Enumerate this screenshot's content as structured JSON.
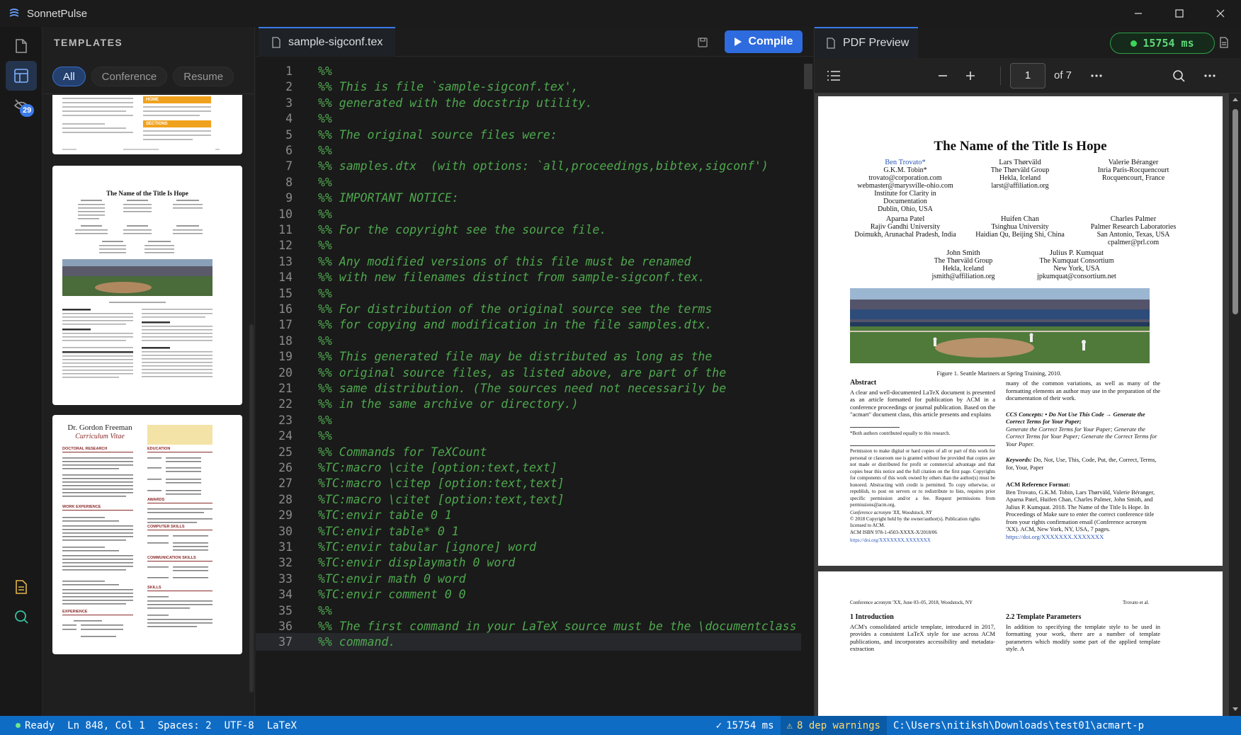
{
  "window": {
    "title": "SonnetPulse"
  },
  "activity": {
    "badge_count": "29"
  },
  "sidebar": {
    "title": "TEMPLATES",
    "filters": [
      {
        "label": "All"
      },
      {
        "label": "Conference"
      },
      {
        "label": "Resume"
      }
    ],
    "card1": {
      "box1": "HOME",
      "box2": "SECTIONS"
    },
    "card2": {
      "title": "The Name of the Title Is Hope"
    },
    "card3": {
      "name": "Dr. Gordon Freeman",
      "subtitle": "Curriculum Vitae",
      "h1": "DOCTORAL RESEARCH",
      "h2": "WORK EXPERIENCE",
      "h3": "EXPERIENCE",
      "r1": "EDUCATION",
      "r2": "AWARDS",
      "r3": "COMPUTER SKILLS",
      "r4": "COMMUNICATION SKILLS",
      "r5": "SKILLS"
    }
  },
  "editor": {
    "tab": {
      "filename": "sample-sigconf.tex"
    },
    "compile_label": "Compile",
    "lines": [
      {
        "n": "1",
        "t": "%%"
      },
      {
        "n": "2",
        "t": "%% This is file `sample-sigconf.tex',"
      },
      {
        "n": "3",
        "t": "%% generated with the docstrip utility."
      },
      {
        "n": "4",
        "t": "%%"
      },
      {
        "n": "5",
        "t": "%% The original source files were:"
      },
      {
        "n": "6",
        "t": "%%"
      },
      {
        "n": "7",
        "t": "%% samples.dtx  (with options: `all,proceedings,bibtex,sigconf')"
      },
      {
        "n": "8",
        "t": "%%"
      },
      {
        "n": "9",
        "t": "%% IMPORTANT NOTICE:"
      },
      {
        "n": "10",
        "t": "%%"
      },
      {
        "n": "11",
        "t": "%% For the copyright see the source file."
      },
      {
        "n": "12",
        "t": "%%"
      },
      {
        "n": "13",
        "t": "%% Any modified versions of this file must be renamed"
      },
      {
        "n": "14",
        "t": "%% with new filenames distinct from sample-sigconf.tex."
      },
      {
        "n": "15",
        "t": "%%"
      },
      {
        "n": "16",
        "t": "%% For distribution of the original source see the terms"
      },
      {
        "n": "17",
        "t": "%% for copying and modification in the file samples.dtx."
      },
      {
        "n": "18",
        "t": "%%"
      },
      {
        "n": "19",
        "t": "%% This generated file may be distributed as long as the"
      },
      {
        "n": "20",
        "t": "%% original source files, as listed above, are part of the"
      },
      {
        "n": "21",
        "t": "%% same distribution. (The sources need not necessarily be"
      },
      {
        "n": "22",
        "t": "%% in the same archive or directory.)"
      },
      {
        "n": "23",
        "t": "%%"
      },
      {
        "n": "24",
        "t": "%%"
      },
      {
        "n": "25",
        "t": "%% Commands for TeXCount"
      },
      {
        "n": "26",
        "t": "%TC:macro \\cite [option:text,text]"
      },
      {
        "n": "27",
        "t": "%TC:macro \\citep [option:text,text]"
      },
      {
        "n": "28",
        "t": "%TC:macro \\citet [option:text,text]"
      },
      {
        "n": "29",
        "t": "%TC:envir table 0 1"
      },
      {
        "n": "30",
        "t": "%TC:envir table* 0 1"
      },
      {
        "n": "31",
        "t": "%TC:envir tabular [ignore] word"
      },
      {
        "n": "32",
        "t": "%TC:envir displaymath 0 word"
      },
      {
        "n": "33",
        "t": "%TC:envir math 0 word"
      },
      {
        "n": "34",
        "t": "%TC:envir comment 0 0"
      },
      {
        "n": "35",
        "t": "%%"
      },
      {
        "n": "36",
        "t": "%% The first command in your LaTeX source must be the \\documentclass"
      },
      {
        "n": "37",
        "t": "%% command."
      }
    ]
  },
  "pdf": {
    "tab_label": "PDF Preview",
    "timer": "15754 ms",
    "page_input": "1",
    "page_total": "of 7",
    "page1": {
      "title": "The Name of the Title Is Hope",
      "authors": [
        {
          "name": "Ben Trovato*",
          "lines": [
            "G.K.M. Tobin*",
            "trovato@corporation.com",
            "webmaster@marysville-ohio.com",
            "Institute for Clarity in",
            "Documentation",
            "Dublin, Ohio, USA"
          ]
        },
        {
          "name": "Lars Thørväld",
          "lines": [
            "The Thørväld Group",
            "Hekla, Iceland",
            "larst@affiliation.org"
          ]
        },
        {
          "name": "Valerie Béranger",
          "lines": [
            "Inria Paris-Rocquencourt",
            "Rocquencourt, France"
          ]
        },
        {
          "name": "Aparna Patel",
          "lines": [
            "Rajiv Gandhi University",
            "Doimukh, Arunachal Pradesh, India"
          ]
        },
        {
          "name": "Huifen Chan",
          "lines": [
            "Tsinghua University",
            "Haidian Qu, Beijing Shi, China"
          ]
        },
        {
          "name": "Charles Palmer",
          "lines": [
            "Palmer Research Laboratories",
            "San Antonio, Texas, USA",
            "cpalmer@prl.com"
          ]
        },
        {
          "name": "John Smith",
          "lines": [
            "The Thørväld Group",
            "Hekla, Iceland",
            "jsmith@affiliation.org"
          ]
        },
        {
          "name": "Julius P. Kumquat",
          "lines": [
            "The Kumquat Consortium",
            "New York, USA",
            "jpkumquat@consortium.net"
          ]
        }
      ],
      "figure_caption": "Figure 1. Seattle Mariners at Spring Training, 2010.",
      "abstract_heading": "Abstract",
      "abstract_text": "A clear and well-documented LaTeX document is presented as an article formatted for publication by ACM in a conference proceedings or journal publication. Based on the \"acmart\" document class, this article presents and explains",
      "footnote": "*Both authors contributed equally to this research.",
      "permission": "Permission to make digital or hard copies of all or part of this work for personal or classroom use is granted without fee provided that copies are not made or distributed for profit or commercial advantage and that copies bear this notice and the full citation on the first page. Copyrights for components of this work owned by others than the author(s) must be honored. Abstracting with credit is permitted. To copy otherwise, or republish, to post on servers or to redistribute to lists, requires prior specific permission and/or a fee. Request permissions from permissions@acm.org.",
      "conf": "Conference acronym 'XX, Woodstock, NY",
      "copyright": "© 2018 Copyright held by the owner/author(s). Publication rights licensed to ACM.",
      "isbn": "ACM ISBN 978-1-4503-XXXX-X/2018/06",
      "doi": "https://doi.org/XXXXXXX.XXXXXXX",
      "right_para": "many of the common variations, as well as many of the formatting elements an author may use in the preparation of the documentation of their work.",
      "ccs_heading": "CCS Concepts: • Do Not Use This Code → Generate the Correct Terms for Your Paper;",
      "ccs_text": "Generate the Correct Terms for Your Paper; Generate the Correct Terms for Your Paper; Generate the Correct Terms for Your Paper.",
      "keywords_heading": "Keywords:",
      "keywords_text": "Do, Not, Use, This, Code, Put, the, Correct, Terms, for, Your, Paper",
      "ref_heading": "ACM Reference Format:",
      "ref_text": "Ben Trovato, G.K.M. Tobin, Lars Thørväld, Valerie Béranger, Aparna Patel, Huifen Chan, Charles Palmer, John Smith, and Julius P. Kumquat. 2018. The Name of the Title Is Hope. In Proceedings of Make sure to enter the correct conference title from your rights confirmation email (Conference acronym 'XX). ACM, New York, NY, USA, 7 pages.",
      "ref_doi": "https://doi.org/XXXXXXX.XXXXXXX"
    },
    "page2": {
      "header_left": "Conference acronym 'XX, June 03–05, 2018, Woodstock, NY",
      "header_right": "Trovato et al.",
      "sec1": "1   Introduction",
      "sec1_text": "ACM's consolidated article template, introduced in 2017, provides a consistent LaTeX style for use across ACM publications, and incorporates accessibility and metadata-extraction",
      "sec2": "2.2   Template Parameters",
      "sec2_text": "In addition to specifying the template style to be used in formatting your work, there are a number of template parameters which modify some part of the applied template style. A"
    }
  },
  "status": {
    "ready": "Ready",
    "position": "Ln 848, Col 1",
    "spaces": "Spaces: 2",
    "encoding": "UTF-8",
    "language": "LaTeX",
    "compile_time": "15754 ms",
    "warnings": "8 dep warnings",
    "path": "C:\\Users\\nitiksh\\Downloads\\test01\\acmart-p"
  }
}
